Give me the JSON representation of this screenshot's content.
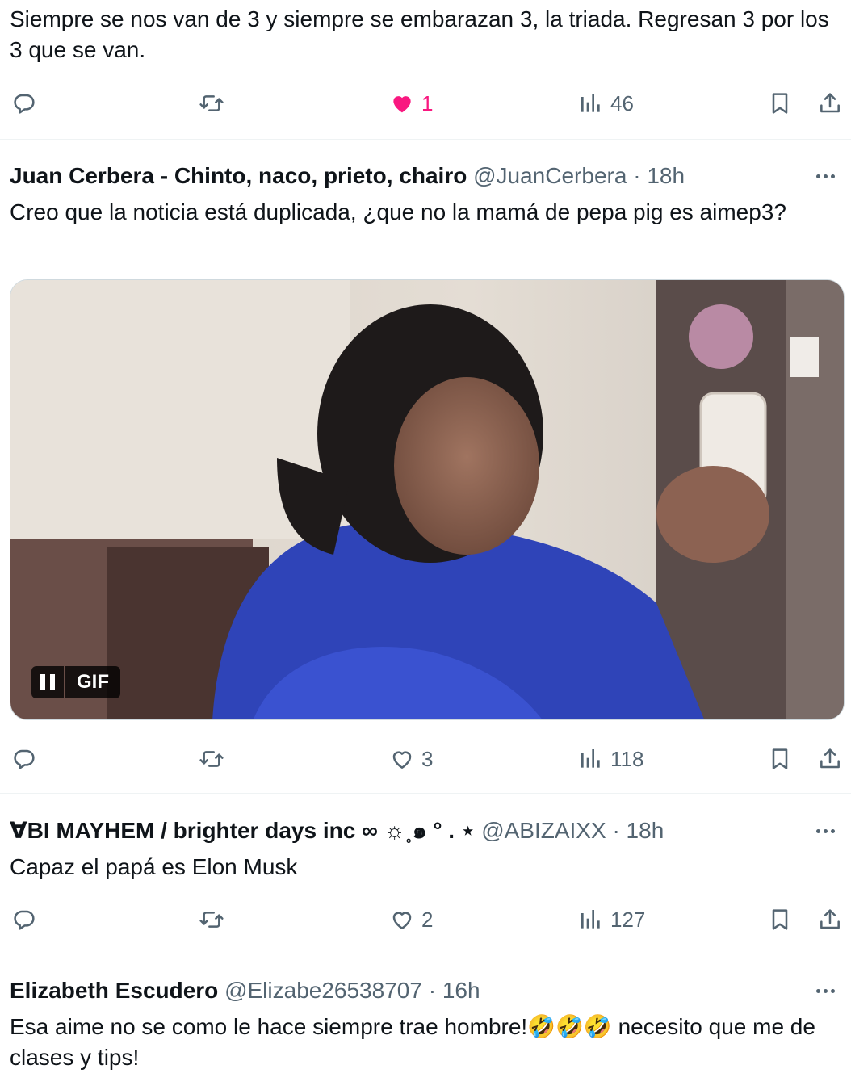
{
  "tweets": [
    {
      "text": "Siempre se nos van de 3 y siempre se embarazan 3, la triada. Regresan 3 por los 3 que se van.",
      "likes": "1",
      "views": "46",
      "liked": true
    },
    {
      "name": "Juan Cerbera - Chinto, naco, prieto, chairo",
      "handle": "@JuanCerbera",
      "time": "18h",
      "text": "Creo que la noticia está duplicada, ¿que no la mamá de pepa pig es aimep3?",
      "media_label": "GIF",
      "likes": "3",
      "views": "118"
    },
    {
      "name": "∀BI MAYHEM / brighter days inc ∞ ☼˳๑ ° . ⋆",
      "handle": "@ABIZAIXX",
      "time": "18h",
      "text": "Capaz el papá es Elon Musk",
      "likes": "2",
      "views": "127"
    },
    {
      "name": "Elizabeth Escudero",
      "handle": "@Elizabe26538707",
      "time": "16h",
      "text": "Esa aime no se como le hace siempre trae hombre!🤣🤣🤣 necesito que me de clases  y tips!"
    }
  ],
  "separator": "·",
  "colors": {
    "text": "#0f1419",
    "secondary": "#536471",
    "like": "#f91880",
    "divider": "#eff3f4"
  },
  "icons": [
    "reply-icon",
    "retweet-icon",
    "heart-icon",
    "views-icon",
    "bookmark-icon",
    "share-icon",
    "more-icon",
    "pause-icon"
  ]
}
